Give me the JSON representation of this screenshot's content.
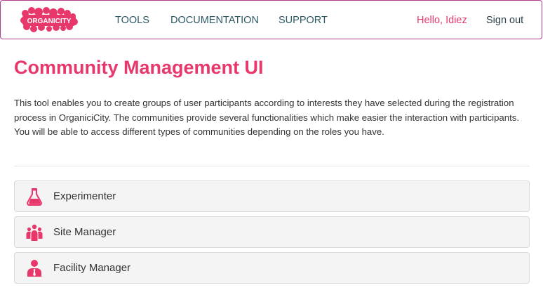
{
  "brand": {
    "logo_text": "ORGANICITY",
    "accent_color": "#e8386b"
  },
  "nav": {
    "items": [
      {
        "label": "TOOLS"
      },
      {
        "label": "DOCUMENTATION"
      },
      {
        "label": "SUPPORT"
      }
    ],
    "greeting": "Hello, Idiez",
    "sign_out": "Sign out"
  },
  "main": {
    "title": "Community Management UI",
    "intro_paragraph_1": "This tool enables you to create groups of user participants according to interests they have selected during the registration process in OrganiciCity. The communities provide several functionalities which make easier the interaction with participants.",
    "intro_paragraph_2": "You will be able to access different types of communities depending on the roles you have."
  },
  "roles": [
    {
      "label": "Experimenter",
      "icon": "flask-icon"
    },
    {
      "label": "Site Manager",
      "icon": "group-icon"
    },
    {
      "label": "Facility Manager",
      "icon": "user-tie-icon"
    }
  ]
}
